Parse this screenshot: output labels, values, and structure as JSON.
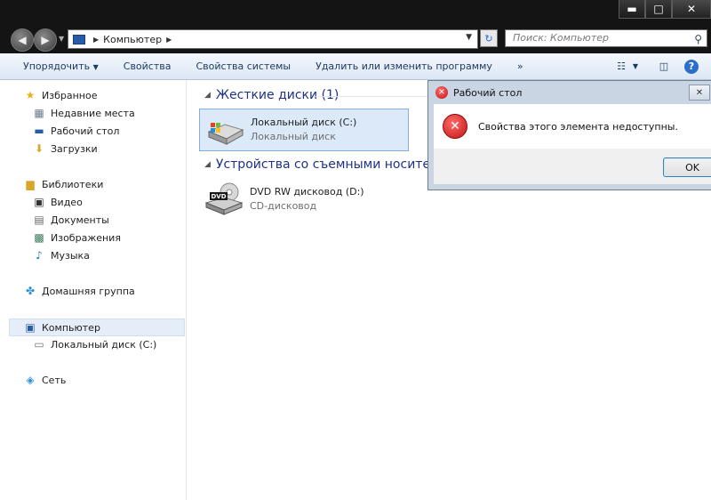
{
  "window": {
    "controls": {
      "minimize": "▬",
      "maximize": "□",
      "close": "✕"
    }
  },
  "address": {
    "path": "Компьютер",
    "search_placeholder": "Поиск: Компьютер"
  },
  "toolbar": {
    "organize": "Упорядочить",
    "properties": "Свойства",
    "system_properties": "Свойства системы",
    "uninstall": "Удалить или изменить программу",
    "more": "»"
  },
  "sidebar": {
    "favorites": "Избранное",
    "recent": "Недавние места",
    "desktop": "Рабочий стол",
    "downloads": "Загрузки",
    "libraries": "Библиотеки",
    "video": "Видео",
    "documents": "Документы",
    "images": "Изображения",
    "music": "Музыка",
    "homegroup": "Домашняя группа",
    "computer": "Компьютер",
    "local_disk": "Локальный диск (C:)",
    "network": "Сеть"
  },
  "main": {
    "hdd_group": "Жесткие диски (1)",
    "removable_group": "Устройства со съемными носителями",
    "drive_c_name": "Локальный диск (C:)",
    "drive_c_type": "Локальный диск",
    "dvd_name": "DVD RW дисковод (D:)",
    "dvd_type": "CD-дисковод",
    "dvd_badge": "DVD"
  },
  "dialog": {
    "title": "Рабочий стол",
    "message": "Свойства этого элемента недоступны.",
    "ok": "OK"
  }
}
